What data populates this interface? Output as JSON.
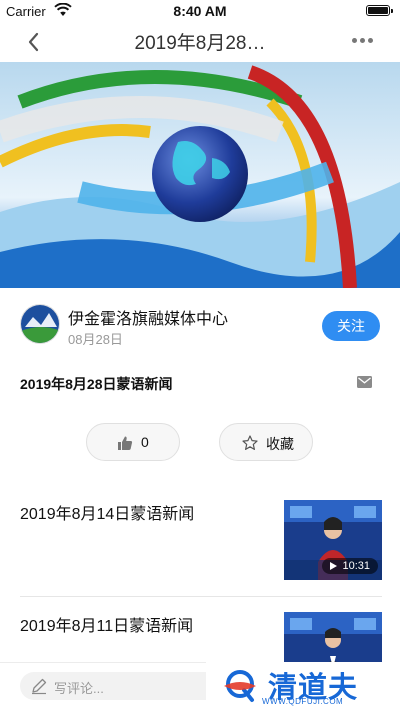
{
  "status_bar": {
    "carrier": "Carrier",
    "time": "8:40 AM",
    "icons": [
      "wifi-icon",
      "battery-icon"
    ]
  },
  "nav": {
    "title": "2019年8月28…",
    "back_icon": "chevron-left-icon",
    "more_icon": "more-dots-icon"
  },
  "video": {
    "description_icon": "video-player"
  },
  "publisher": {
    "name": "伊金霍洛旗融媒体中心",
    "date": "08月28日",
    "follow_label": "关注"
  },
  "article": {
    "headline": "2019年8月28日蒙语新闻"
  },
  "actions": {
    "like_count": "0",
    "favorite_label": "收藏"
  },
  "related": [
    {
      "title": "2019年8月14日蒙语新闻",
      "duration": "10:31"
    },
    {
      "title": "2019年8月11日蒙语新闻"
    }
  ],
  "comment": {
    "placeholder": "写评论..."
  },
  "watermark": {
    "name": "清道夫",
    "url": "WWW.QDFUJI.COM"
  },
  "colors": {
    "accent": "#2f8df2",
    "watermark": "#1768d6",
    "muted": "#999999"
  }
}
